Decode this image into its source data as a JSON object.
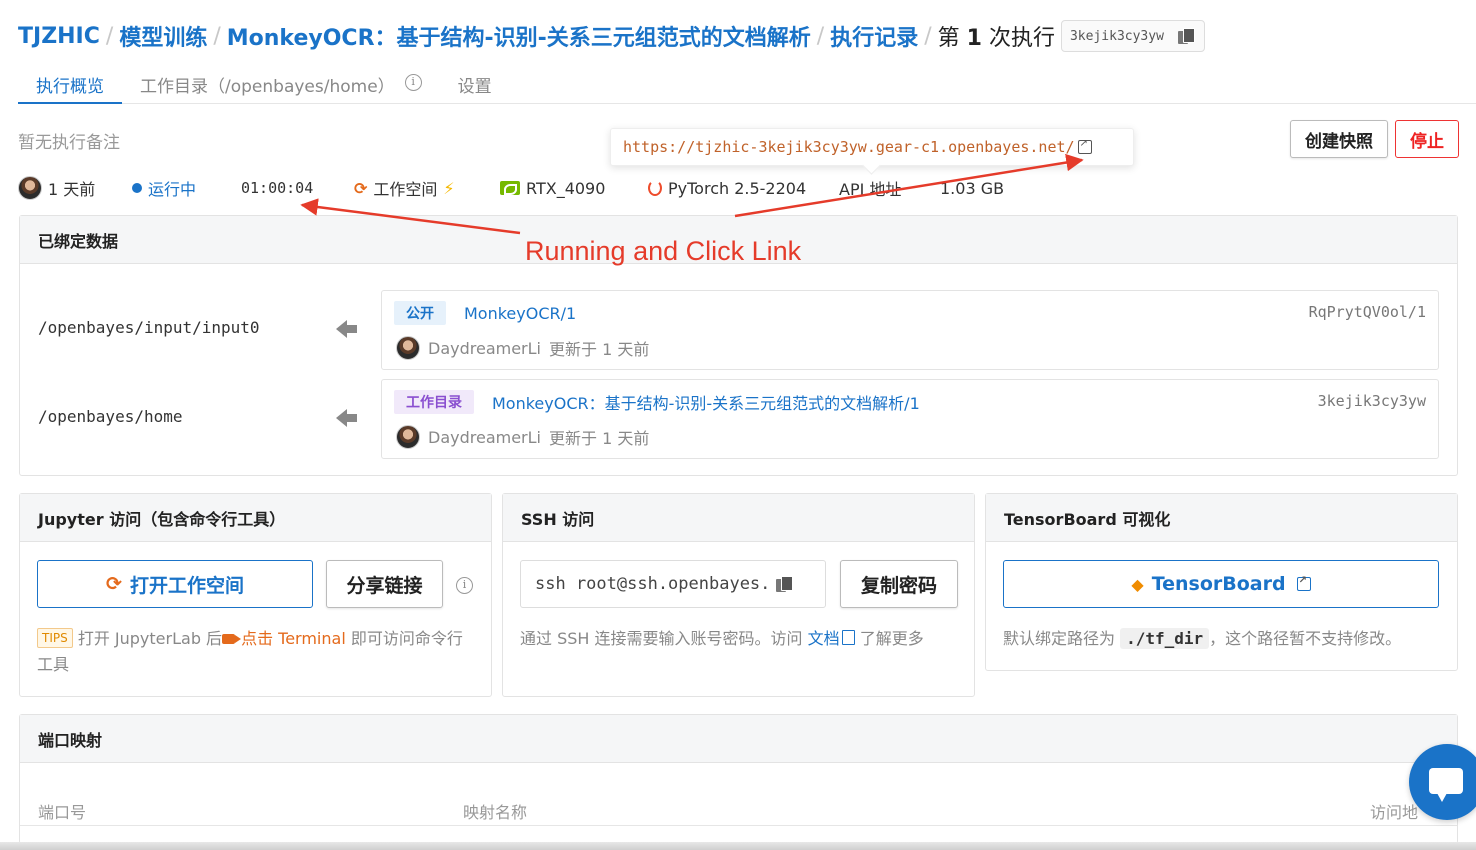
{
  "breadcrumb": {
    "org": "TJZHIC",
    "section": "模型训练",
    "project": "MonkeyOCR：基于结构-识别-关系三元组范式的文档解析",
    "records": "执行记录",
    "current_prefix": "第",
    "current_number": "1",
    "current_suffix": "次执行",
    "run_id": "3kejik3cy3yw",
    "separator": "/"
  },
  "tabs": [
    {
      "label": "执行概览",
      "active": true
    },
    {
      "label": "工作目录（/openbayes/home）",
      "active": false
    },
    {
      "label": "设置",
      "active": false
    }
  ],
  "note": "暂无执行备注",
  "actions": {
    "snapshot": "创建快照",
    "stop": "停止"
  },
  "tooltip_url": "https://tjzhic-3kejik3cy3yw.gear-c1.openbayes.net/",
  "status": {
    "time_ago": "1 天前",
    "state": "运行中",
    "duration": "01:00:04",
    "workspace": "工作空间",
    "gpu": "RTX_4090",
    "framework": "PyTorch 2.5-2204",
    "api": "API 地址",
    "size": "1.03 GB"
  },
  "bound_data": {
    "title": "已绑定数据",
    "rows": [
      {
        "path": "/openbayes/input/input0",
        "tag": "公开",
        "name": "MonkeyOCR/1",
        "id": "RqPrytQV0ol/1",
        "user": "DaydreamerLi",
        "updated": "更新于 1 天前"
      },
      {
        "path": "/openbayes/home",
        "tag": "工作目录",
        "name": "MonkeyOCR：基于结构-识别-关系三元组范式的文档解析/1",
        "id": "3kejik3cy3yw",
        "user": "DaydreamerLi",
        "updated": "更新于 1 天前"
      }
    ]
  },
  "jupyter": {
    "title": "Jupyter 访问（包含命令行工具）",
    "open_button": "打开工作空间",
    "share_button": "分享链接",
    "tips_tag": "TIPS",
    "tips_before": "打开 JupyterLab 后",
    "tips_link": "点击 Terminal",
    "tips_after": "即可访问命令行工具"
  },
  "ssh": {
    "title": "SSH 访问",
    "command": "ssh root@ssh.openbayes.",
    "copy_button": "复制密码",
    "help_before": "通过 SSH 连接需要输入账号密码。访问",
    "help_link": "文档",
    "help_after": "了解更多"
  },
  "tensorboard": {
    "title": "TensorBoard 可视化",
    "button": "TensorBoard",
    "help_before": "默认绑定路径为",
    "path": "./tf_dir",
    "help_after": "，这个路径暂不支持修改。"
  },
  "ports": {
    "title": "端口映射",
    "col_port": "端口号",
    "col_name": "映射名称",
    "col_access": "访问地"
  },
  "annotation_text": "Running and Click Link",
  "colors": {
    "primary": "#1a73c8",
    "danger": "#e22222",
    "annotation": "#e53b2a",
    "workspace_orange": "#e46a1c"
  }
}
